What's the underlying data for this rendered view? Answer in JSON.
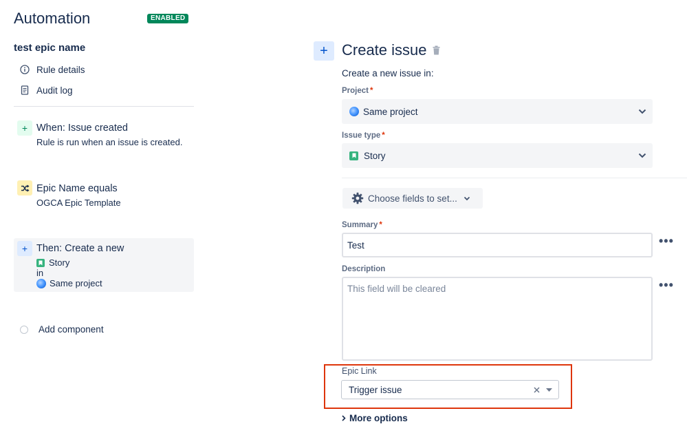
{
  "header": {
    "title": "Automation",
    "badge": "ENABLED"
  },
  "rule": {
    "name": "test epic name"
  },
  "nav": [
    {
      "label": "Rule details",
      "icon": "info-icon"
    },
    {
      "label": "Audit log",
      "icon": "document-icon"
    }
  ],
  "components": {
    "trigger": {
      "title": "When: Issue created",
      "subtitle": "Rule is run when an issue is created.",
      "icon": "plus-icon"
    },
    "condition": {
      "title": "Epic Name equals",
      "subtitle": "OGCA Epic Template",
      "icon": "shuffle-icon"
    },
    "action": {
      "title": "Then: Create a new",
      "type": "Story",
      "connector": "in",
      "project": "Same project",
      "icon": "plus-icon"
    },
    "add_label": "Add component"
  },
  "panel": {
    "title": "Create issue",
    "intro": "Create a new issue in:",
    "project": {
      "label": "Project",
      "value": "Same project"
    },
    "issue_type": {
      "label": "Issue type",
      "value": "Story"
    },
    "choose_fields": "Choose fields to set...",
    "summary": {
      "label": "Summary",
      "value": "Test"
    },
    "description": {
      "label": "Description",
      "placeholder": "This field will be cleared"
    },
    "epic_link": {
      "label": "Epic Link",
      "value": "Trigger issue"
    },
    "more_options": "More options"
  },
  "colors": {
    "accent": "#0052cc",
    "badge": "#00875a",
    "highlight": "#de350b",
    "story": "#36b37e"
  }
}
